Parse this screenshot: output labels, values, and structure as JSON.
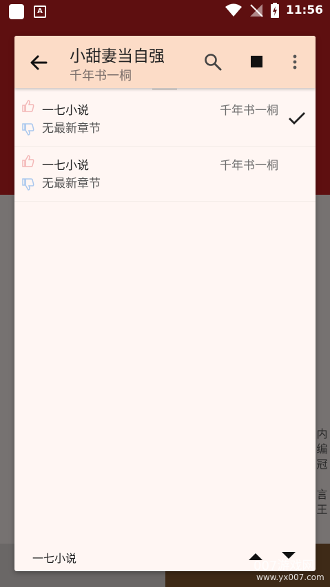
{
  "status_bar": {
    "time": "11:56",
    "app_icon_label": "A"
  },
  "toolbar": {
    "title": "小甜妻当自强",
    "subtitle": "千年书一桐",
    "icons": [
      "back-arrow-icon",
      "search-icon",
      "stop-icon",
      "more-vert-icon"
    ]
  },
  "sources": [
    {
      "name": "一七小说",
      "author": "千年书一桐",
      "latest": "无最新章节",
      "selected": true
    },
    {
      "name": "一七小说",
      "author": "千年书一桐",
      "latest": "无最新章节",
      "selected": false
    }
  ],
  "footer": {
    "current_source": "一七小说"
  },
  "background": {
    "side_text": "内\n编\n冠\n\n言\n王"
  },
  "watermark": {
    "text": "007游戏网",
    "url": "www.yx007.com"
  },
  "colors": {
    "toolbar_bg": "#fcdcc7",
    "dialog_bg": "#fff6f3",
    "background_top": "#5e0f10",
    "thumb_up": "#f3b7b7",
    "thumb_down": "#a9c7ee"
  }
}
